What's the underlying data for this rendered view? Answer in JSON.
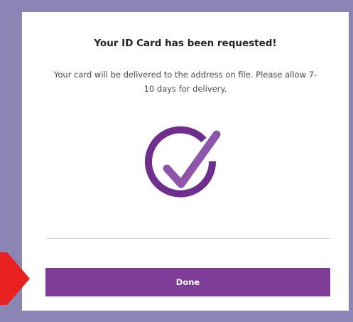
{
  "dialog": {
    "title": "Your ID Card has been requested!",
    "message": "Your card will be delivered to the address on file. Please allow 7-10 days for delivery.",
    "done_label": "Done"
  },
  "icons": {
    "success": "check-circle-icon",
    "pointer": "red-arrow-pointer"
  },
  "colors": {
    "brand_purple": "#7e3d97",
    "frame_lavender": "#8a85b2",
    "arrow_red": "#e8201f"
  }
}
